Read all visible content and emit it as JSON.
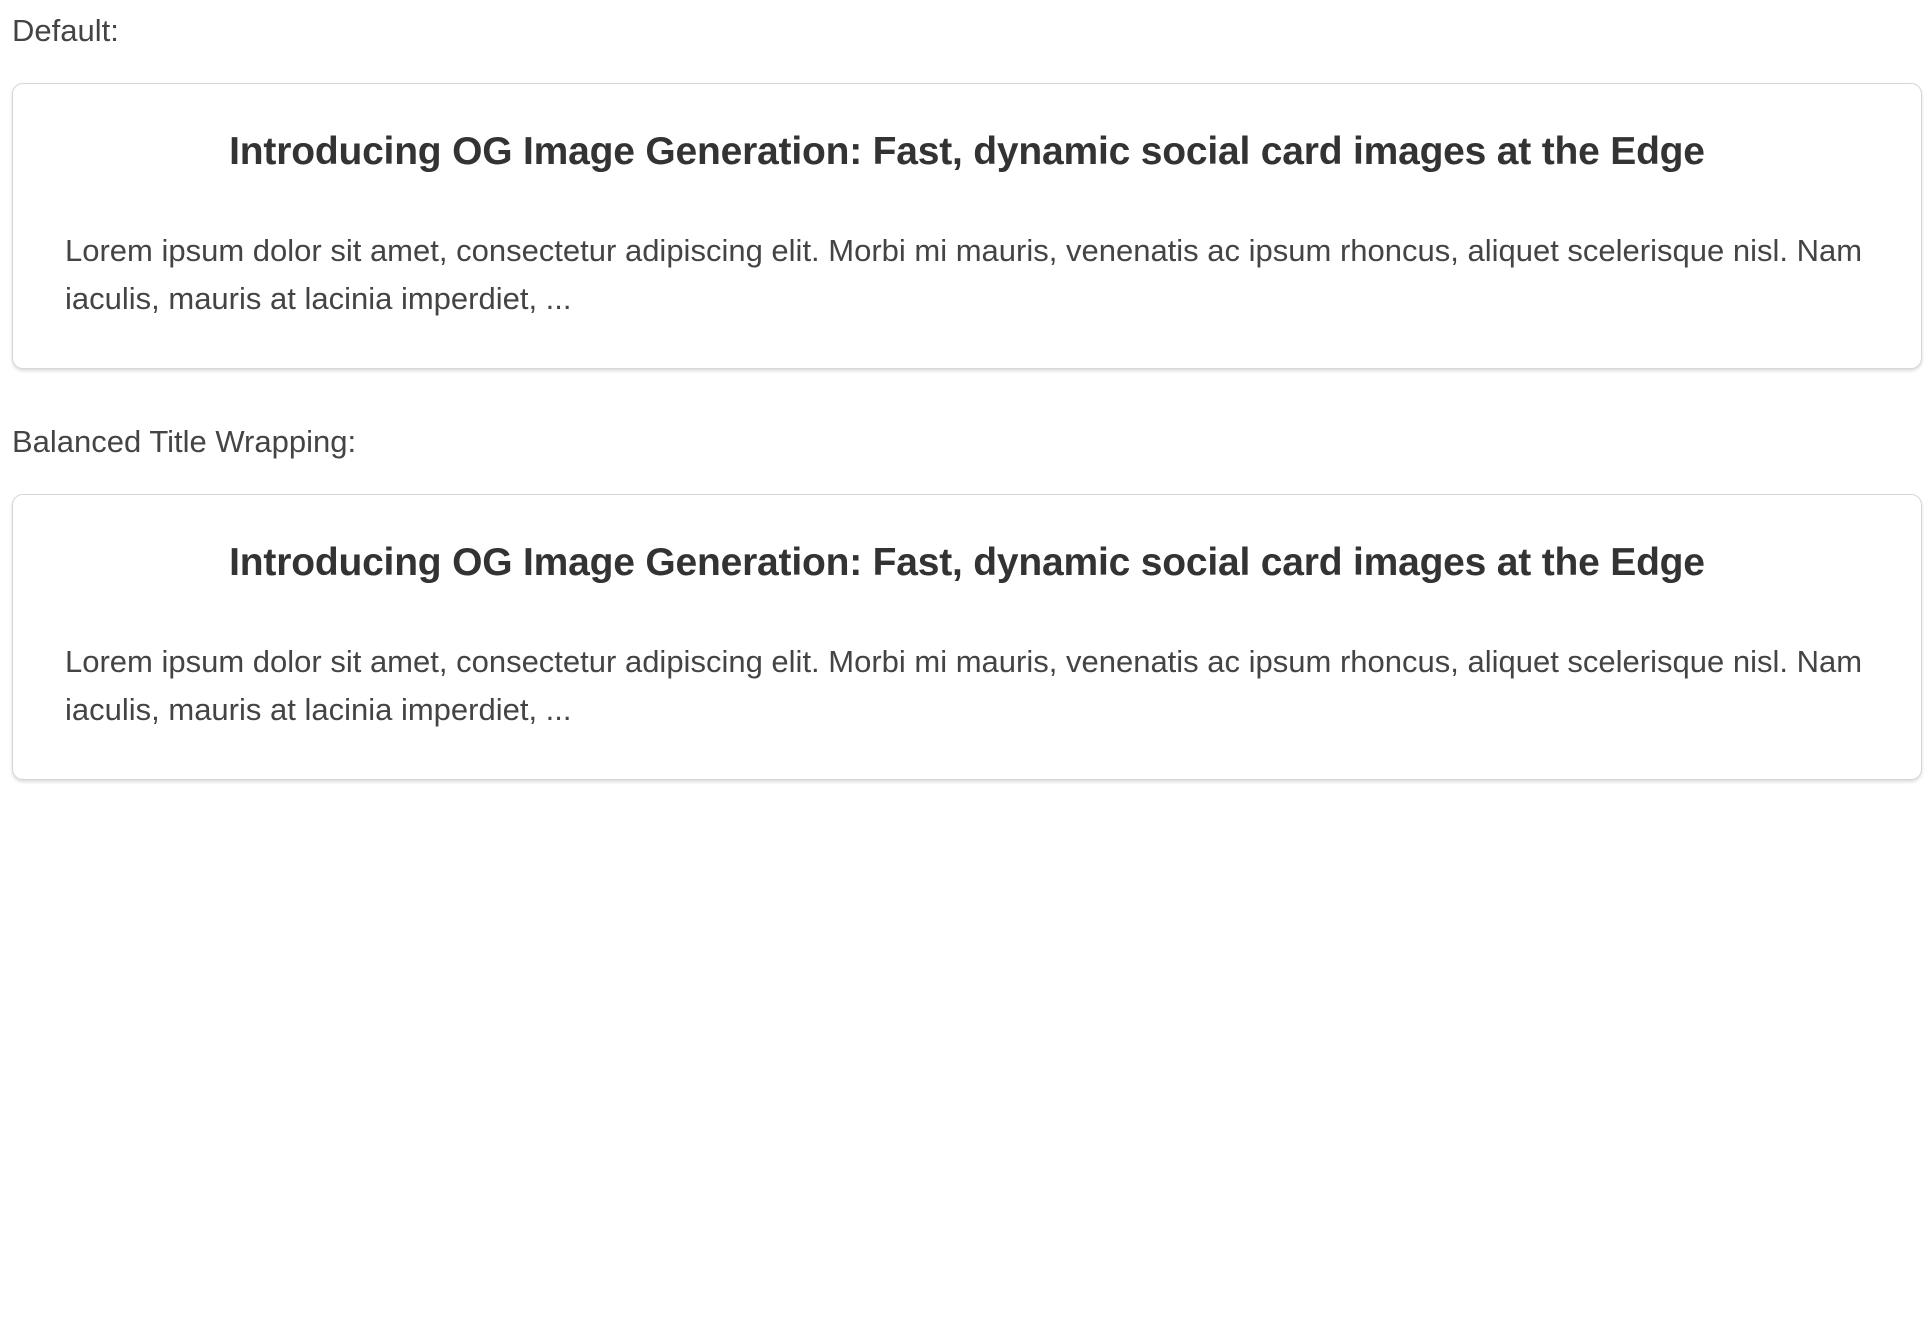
{
  "sections": [
    {
      "label": "Default:",
      "card": {
        "title": "Introducing OG Image Generation: Fast, dynamic social card images at the Edge",
        "body": "Lorem ipsum dolor sit amet, consectetur adipiscing elit. Morbi mi mauris, venenatis ac ipsum rhoncus, aliquet scelerisque nisl. Nam iaculis, mauris at lacinia imperdiet, ..."
      }
    },
    {
      "label": "Balanced Title Wrapping:",
      "card": {
        "title": "Introducing OG Image Generation: Fast, dynamic social card images at the Edge",
        "body": "Lorem ipsum dolor sit amet, consectetur adipiscing elit. Morbi mi mauris, venenatis ac ipsum rhoncus, aliquet scelerisque nisl. Nam iaculis, mauris at lacinia imperdiet, ..."
      }
    }
  ],
  "colors": {
    "text": "#333333",
    "muted_text": "#444444",
    "card_border": "#d6d6d6",
    "background": "#ffffff"
  }
}
